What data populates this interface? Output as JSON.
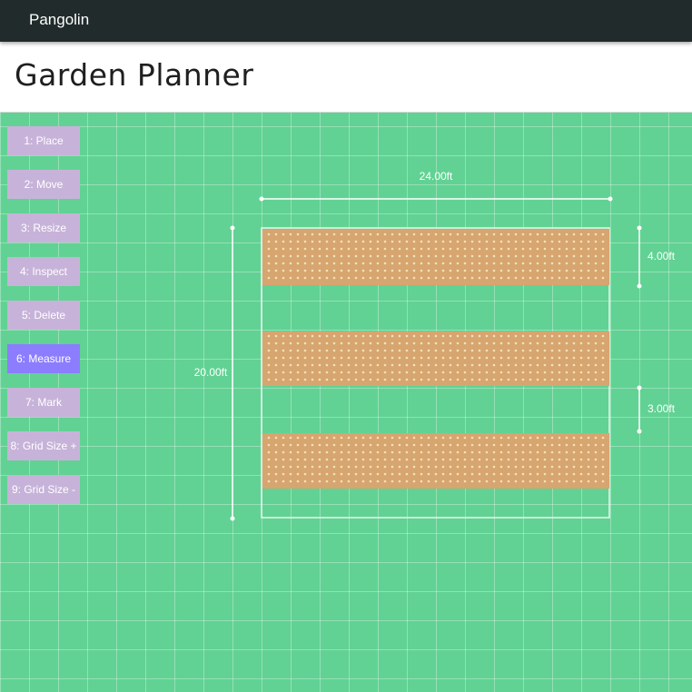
{
  "navbar": {
    "brand": "Pangolin"
  },
  "page": {
    "title": "Garden Planner"
  },
  "tools": [
    {
      "label": "1: Place",
      "active": false
    },
    {
      "label": "2: Move",
      "active": false
    },
    {
      "label": "3: Resize",
      "active": false
    },
    {
      "label": "4: Inspect",
      "active": false
    },
    {
      "label": "5: Delete",
      "active": false
    },
    {
      "label": "6: Measure",
      "active": true
    },
    {
      "label": "7: Mark",
      "active": false
    },
    {
      "label": "8: Grid Size +",
      "active": false
    },
    {
      "label": "9: Grid Size -",
      "active": false
    }
  ],
  "measurements": {
    "total_width": "24.00ft",
    "total_height": "20.00ft",
    "bed_depth": "4.00ft",
    "path_gap": "3.00ft"
  },
  "colors": {
    "grass": "#61d293",
    "bed_soil": "#d7a56f",
    "active_tool": "#8c7dff",
    "tool": "#c7b3d9",
    "navbar": "#212b2b"
  }
}
